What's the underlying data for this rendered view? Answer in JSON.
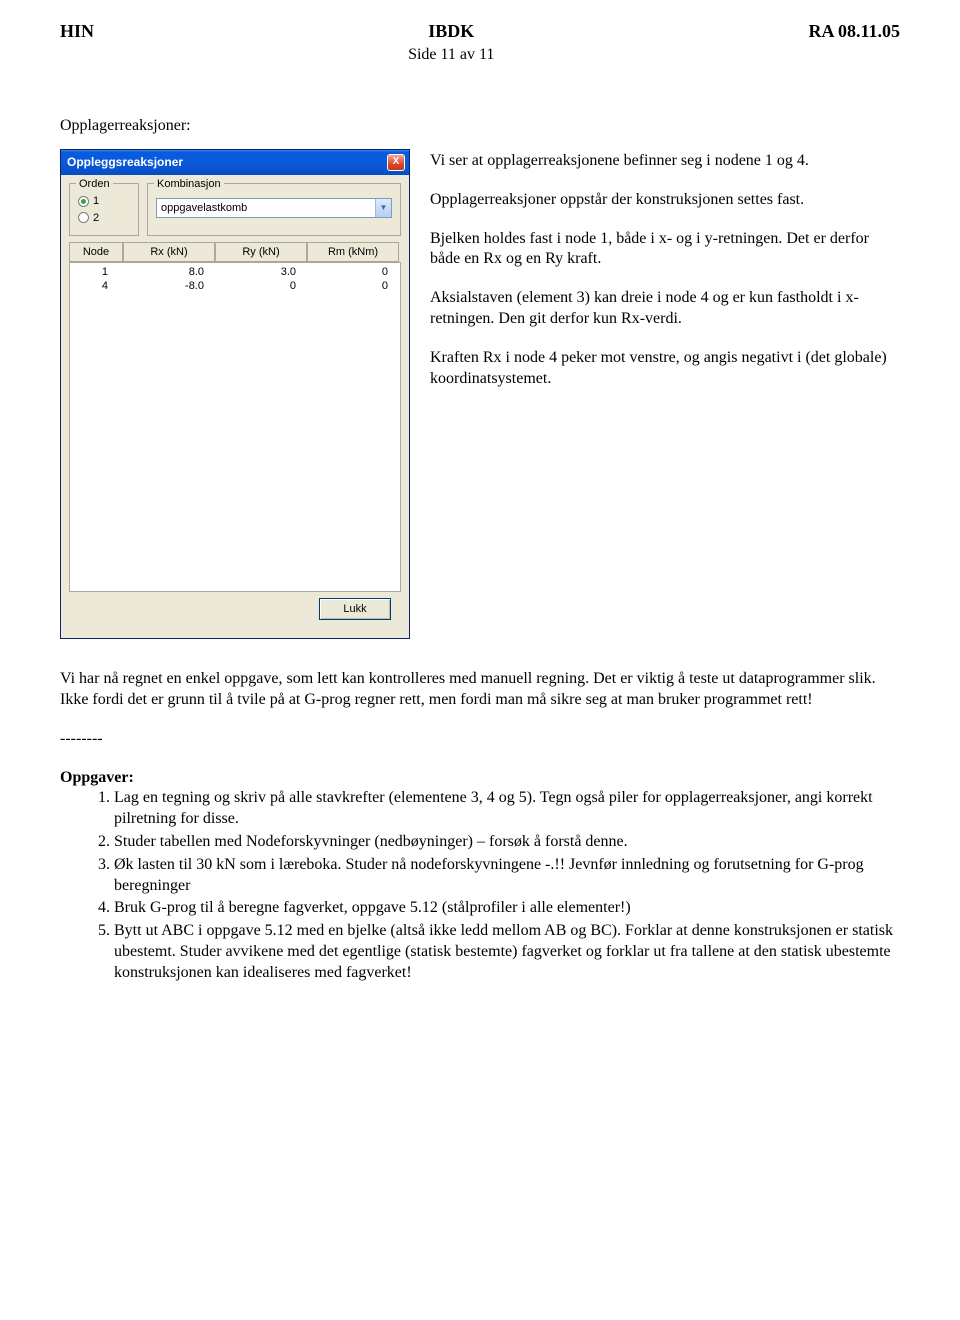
{
  "header": {
    "left": "HIN",
    "center": "IBDK",
    "right": "RA 08.11.05",
    "subpage": "Side 11 av 11"
  },
  "section": {
    "title": "Opplagerreaksjoner:"
  },
  "dialog": {
    "title": "Oppleggsreaksjoner",
    "close": "X",
    "orden": {
      "legend": "Orden",
      "opt1": "1",
      "opt2": "2"
    },
    "komb": {
      "legend": "Kombinasjon",
      "value": "oppgavelastkomb"
    },
    "headers": {
      "node": "Node",
      "rx": "Rx (kN)",
      "ry": "Ry (kN)",
      "rm": "Rm (kNm)"
    },
    "rows": [
      {
        "node": "1",
        "rx": "8.0",
        "ry": "3.0",
        "rm": "0"
      },
      {
        "node": "4",
        "rx": "-8.0",
        "ry": "0",
        "rm": "0"
      }
    ],
    "lukk": "Lukk"
  },
  "right": {
    "p1": "Vi ser at opplagerreaksjonene befinner seg i nodene 1 og 4.",
    "p2": "Opplagerreaksjoner oppstår der konstruksjonen settes fast.",
    "p3": "Bjelken holdes fast i node 1, både i x- og i y-retningen. Det er derfor både en Rx og en Ry kraft.",
    "p4": "Aksialstaven (element 3) kan dreie i node 4 og er kun fastholdt i x-retningen. Den git derfor kun Rx-verdi.",
    "p5": "Kraften Rx i node 4 peker mot venstre, og angis negativt i (det globale) koordinatsystemet."
  },
  "lower": {
    "p1": "Vi har nå regnet en enkel oppgave, som lett kan kontrolleres med manuell regning. Det er viktig å teste ut dataprogrammer slik. Ikke fordi det er grunn til å tvile på at G-prog regner rett, men fordi man må sikre seg at man bruker programmet rett!",
    "dashes": "--------",
    "oppgaver_title": "Oppgaver:",
    "items": {
      "i1": "Lag en tegning og skriv på alle stavkrefter (elementene 3, 4 og 5). Tegn også piler for opplagerreaksjoner, angi korrekt pilretning for disse.",
      "i2": "Studer tabellen med Nodeforskyvninger (nedbøyninger) – forsøk å forstå denne.",
      "i3": "Øk lasten til 30 kN som i læreboka. Studer nå nodeforskyvningene -.!! Jevnfør innledning og forutsetning for G-prog beregninger",
      "i4": "Bruk G-prog til å beregne fagverket, oppgave 5.12 (stålprofiler i alle elementer!)",
      "i5": "Bytt ut ABC i oppgave 5.12 med en bjelke (altså ikke ledd mellom AB og BC). Forklar at denne konstruksjonen er statisk ubestemt. Studer avvikene med det egentlige (statisk bestemte) fagverket og forklar ut fra tallene at den statisk ubestemte konstruksjonen kan idealiseres med fagverket!"
    }
  }
}
